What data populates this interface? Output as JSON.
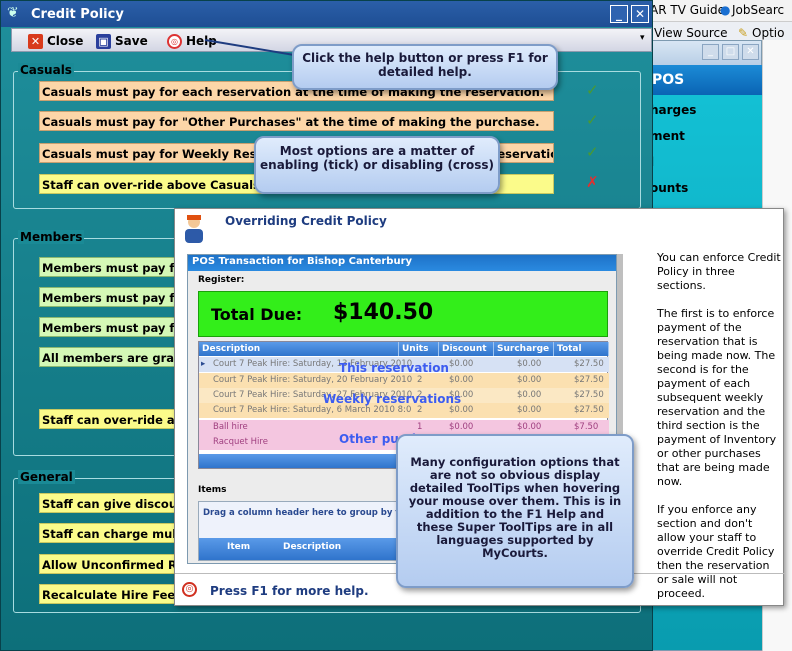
{
  "background_app": {
    "menubar": {
      "item1": "AR TV Guide",
      "item2": "JobSearc"
    },
    "toolbar": {
      "item1": "View Source",
      "item2": "Optio"
    },
    "pos_panel": {
      "header": "POS",
      "items": [
        "harges",
        "ment",
        "l",
        "ounts"
      ]
    }
  },
  "window": {
    "title": "Credit Policy",
    "minimize_label": "_",
    "close_label": "✕"
  },
  "toolbar": {
    "close_label": "Close",
    "save_label": "Save",
    "help_label": "Help"
  },
  "help_callout": "Click the help button or press F1 for detailed help.",
  "options_callout": "Most options are a matter of enabling (tick) or disabling (cross)",
  "tooltips_callout": "Many configuration options that are not so obvious display detailed ToolTips when hovering your mouse over them. This is in addition to the F1 Help and these Super ToolTips are in all languages supported by MyCourts.",
  "casuals": {
    "label": "Casuals",
    "options": [
      "Casuals must pay for each reservation at the time of making the reservation.",
      "Casuals must pay for \"Other Purchases\" at the time of making the purchase.",
      "Casuals must pay for Weekly Reservations at the time of making the reservation.",
      "Staff can over-ride above Casuals settings at time of Sale."
    ],
    "states": [
      "enabled",
      "enabled",
      "enabled",
      "disabled"
    ]
  },
  "members": {
    "label": "Members",
    "options": [
      "Members must pay for",
      "Members must pay for",
      "Members must pay for",
      "All members are grante",
      "Staff can over-ride abov"
    ]
  },
  "general": {
    "label": "General",
    "options": [
      "Staff can give discounts",
      "Staff can charge multip",
      "Allow Unconfirmed Rese",
      "Recalculate Hire Fee at"
    ]
  },
  "supertip": {
    "title": "Overriding Credit Policy",
    "description": [
      "You can enforce Credit Policy in three sections.",
      "The first is to enforce payment of the reservation that is being made now. The second is for the payment of each subsequent weekly reservation and the third section is the payment of Inventory or other purchases that are being made now.",
      "If you enforce any section and don't allow your staff to override Credit Policy then the reservation or sale will not proceed."
    ],
    "footer": "Press F1 for more help.",
    "pos": {
      "title": "POS Transaction for Bishop Canterbury",
      "register_label": "Register:",
      "total_label": "Total Due:",
      "total_value": "$140.50",
      "columns": [
        "Description",
        "Units",
        "Discount",
        "Surcharge",
        "Total"
      ],
      "rows": [
        {
          "description": "Court 7 Peak Hire: Saturday, 13 February 2010",
          "units": "",
          "discount": "$0.00",
          "surcharge": "$0.00",
          "total": "$27.50"
        },
        {
          "description": "Court 7 Peak Hire: Saturday, 20 February 2010",
          "units": "2",
          "discount": "$0.00",
          "surcharge": "$0.00",
          "total": "$27.50"
        },
        {
          "description": "Court 7 Peak Hire: Saturday, 27 February 2010",
          "units": "2",
          "discount": "$0.00",
          "surcharge": "$0.00",
          "total": "$27.50"
        },
        {
          "description": "Court 7 Peak Hire: Saturday, 6 March 2010 8:0",
          "units": "2",
          "discount": "$0.00",
          "surcharge": "$0.00",
          "total": "$27.50"
        },
        {
          "description": "Ball hire",
          "units": "1",
          "discount": "$0.00",
          "surcharge": "$0.00",
          "total": "$7.50"
        },
        {
          "description": "Racquet Hire",
          "units": "",
          "discount": "",
          "surcharge": "",
          "total": ""
        }
      ],
      "overlay_labels": {
        "this_reservation": "This reservation",
        "weekly": "Weekly reservations",
        "other": "Other purchases"
      },
      "items_label": "Items",
      "group_hint": "Drag a column header here to group by that colu",
      "item_columns": [
        "Item",
        "Description"
      ]
    }
  },
  "colors": {
    "window_bg": "#1a8a96",
    "title_bar": "#2b5fa8",
    "peach_option": "#fcd6a8",
    "yellow_option": "#fbfb8a",
    "green_option": "#d4f8b6",
    "total_green": "#33ee1a"
  }
}
